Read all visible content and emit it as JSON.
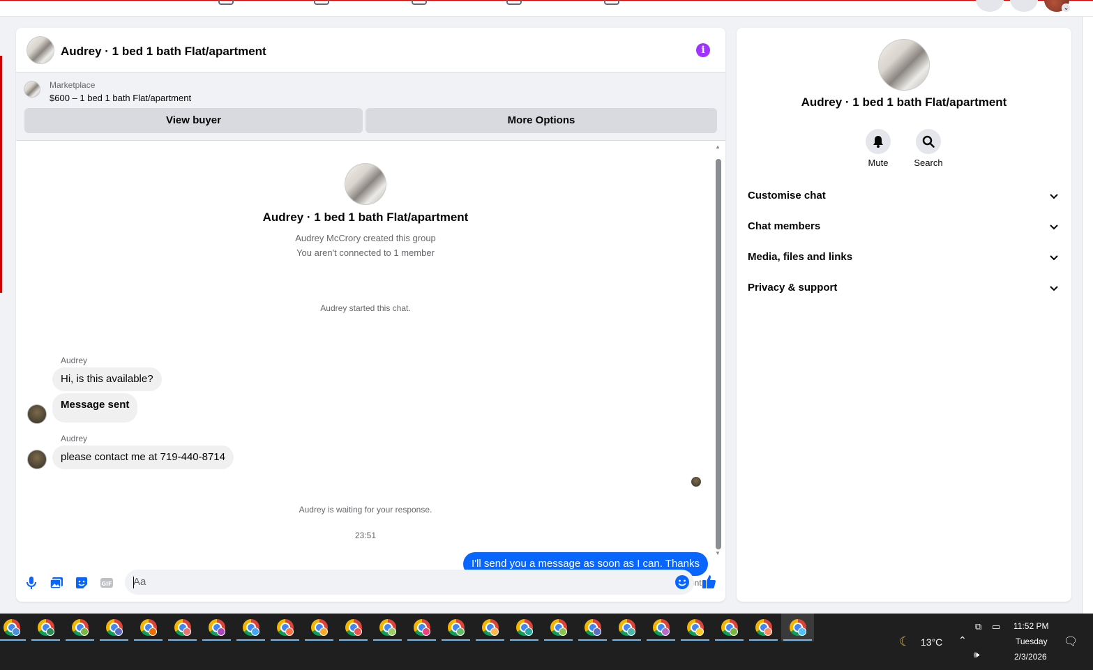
{
  "chat": {
    "title": "Audrey · 1 bed 1 bath Flat/apartment",
    "marketplace_label": "Marketplace",
    "listing": "$600 – 1 bed 1 bath Flat/apartment",
    "view_buyer": "View buyer",
    "more_options": "More Options",
    "intro_title": "Audrey · 1 bed 1 bath Flat/apartment",
    "intro_created": "Audrey McCrory created this group",
    "intro_connected": "You aren't connected to 1 member",
    "started": "Audrey started this chat.",
    "messages": [
      {
        "sender": "Audrey",
        "text": "Hi, is this available?"
      },
      {
        "text": "Message sent"
      },
      {
        "sender": "Audrey",
        "text": "please contact me at 719-440-8714"
      }
    ],
    "waiting": "Audrey is waiting for your response.",
    "time": "23:51",
    "outgoing": "I'll send you a message as soon as I can. Thanks",
    "status": "Sent",
    "composer_placeholder": "Aa"
  },
  "info": {
    "title": "Audrey · 1 bed 1 bath Flat/apartment",
    "mute_label": "Mute",
    "search_label": "Search",
    "sections": [
      "Customise chat",
      "Chat members",
      "Media, files and links",
      "Privacy & support"
    ]
  },
  "taskbar": {
    "temperature": "13°C",
    "time": "11:52 PM",
    "day": "Tuesday",
    "date": "2/3/2026",
    "badge_colors": [
      "#4a90d9",
      "#2e8b57",
      "#7cb342",
      "#5c6bc0",
      "#ef6c00",
      "#e57373",
      "#ab47bc",
      "#42a5f5",
      "#ff7043",
      "#ffa726",
      "#ef5350",
      "#9ccc65",
      "#ec407a",
      "#66bb6a",
      "#ffb74d",
      "#26a69a",
      "#8bc34a",
      "#5c6bc0",
      "#4db6ac",
      "#ba68c8",
      "#ffca28",
      "#7cb342",
      "#ff8a65",
      "#4fc3f7"
    ]
  },
  "colors": {
    "accent": "#0866ff",
    "info_icon": "#a033ff"
  }
}
